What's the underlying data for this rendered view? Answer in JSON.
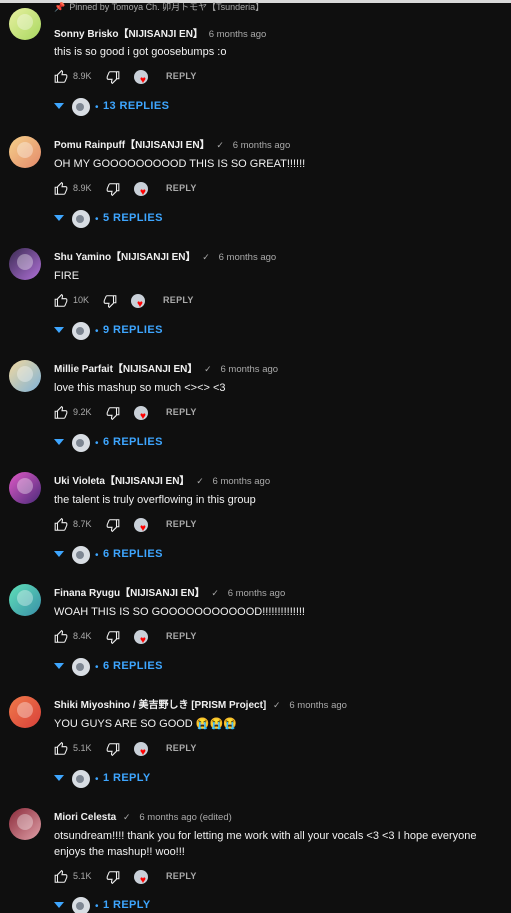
{
  "pinned_label": "Pinned by Tomoya Ch. 卯月トモヤ【Tsunderia】",
  "reply_label": "REPLY",
  "accent_color": "#3ea6ff",
  "heart_color": "#ff0000",
  "comments": [
    {
      "author": "Sonny Brisko【NIJISANJI EN】",
      "time": "6 months ago",
      "text": "this is so good i got goosebumps :o",
      "likes": "8.9K",
      "replies": "13 REPLIES",
      "pinned": true
    },
    {
      "author": "Pomu Rainpuff【NIJISANJI EN】",
      "time": "6 months ago",
      "text": "OH MY GOOOOOOOOOD THIS IS SO GREAT!!!!!!",
      "likes": "8.9K",
      "replies": "5 REPLIES"
    },
    {
      "author": "Shu Yamino【NIJISANJI EN】",
      "time": "6 months ago",
      "text": "FIRE",
      "likes": "10K",
      "replies": "9 REPLIES"
    },
    {
      "author": "Millie Parfait【NIJISANJI EN】",
      "time": "6 months ago",
      "text": "love this mashup so much <><> <3",
      "likes": "9.2K",
      "replies": "6 REPLIES"
    },
    {
      "author": "Uki Violeta【NIJISANJI EN】",
      "time": "6 months ago",
      "text": "the talent is truly overflowing in this group",
      "likes": "8.7K",
      "replies": "6 REPLIES"
    },
    {
      "author": "Finana Ryugu【NIJISANJI EN】",
      "time": "6 months ago",
      "text": "WOAH THIS IS SO GOOOOOOOOOOOD!!!!!!!!!!!!!!",
      "likes": "8.4K",
      "replies": "6 REPLIES"
    },
    {
      "author": "Shiki Miyoshino / 美吉野しき [PRISM Project]",
      "time": "6 months ago",
      "text": "YOU GUYS ARE SO GOOD 😭😭😭",
      "likes": "5.1K",
      "replies": "1 REPLY"
    },
    {
      "author": "Miori Celesta",
      "time": "6 months ago (edited)",
      "text": "otsundream!!!! thank you for letting me work with all your vocals <3 <3 I hope everyone enjoys the mashup!! woo!!!",
      "likes": "5.1K",
      "replies": "1 REPLY"
    }
  ]
}
